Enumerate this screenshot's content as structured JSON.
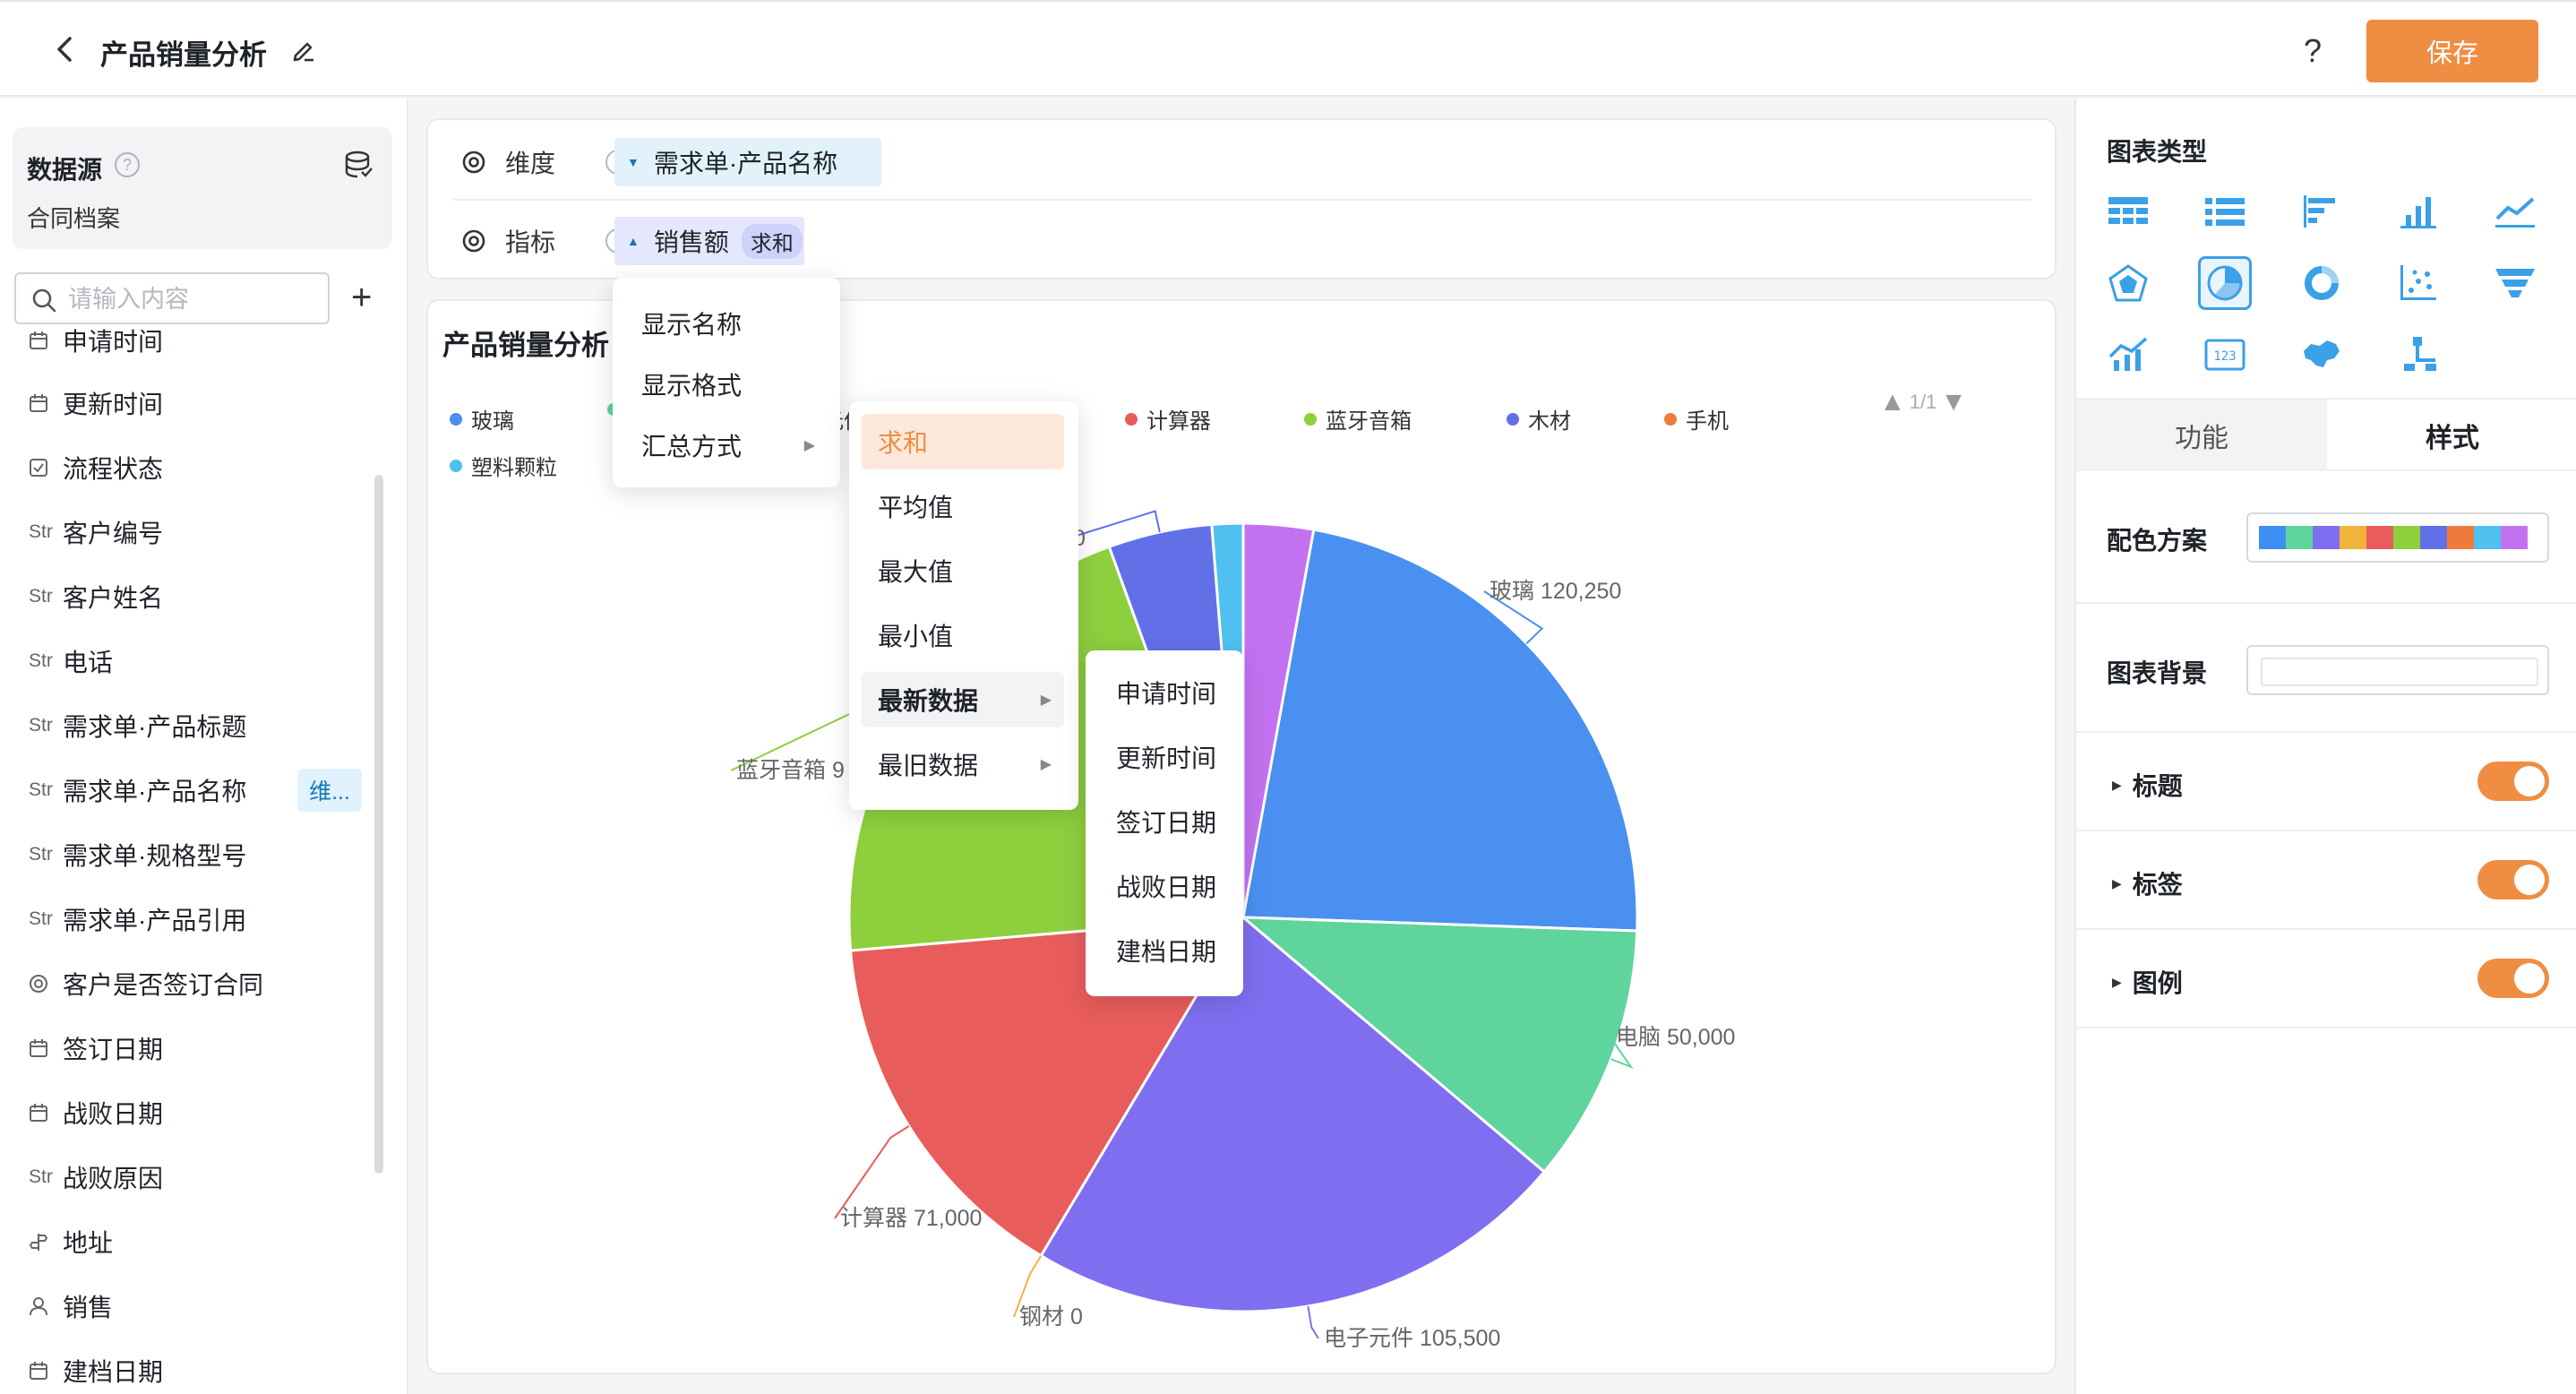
{
  "header": {
    "title": "产品销量分析",
    "help": "?",
    "save_label": "保存"
  },
  "datasource": {
    "title": "数据源",
    "help": "?",
    "name": "合同档案"
  },
  "search": {
    "placeholder": "请输入内容",
    "add": "+"
  },
  "fields": [
    {
      "type": "date",
      "label": "申请时间"
    },
    {
      "type": "date",
      "label": "更新时间"
    },
    {
      "type": "check",
      "label": "流程状态"
    },
    {
      "type": "Str",
      "label": "客户编号"
    },
    {
      "type": "Str",
      "label": "客户姓名"
    },
    {
      "type": "Str",
      "label": "电话"
    },
    {
      "type": "Str",
      "label": "需求单·产品标题"
    },
    {
      "type": "Str",
      "label": "需求单·产品名称",
      "tag": "维..."
    },
    {
      "type": "Str",
      "label": "需求单·规格型号"
    },
    {
      "type": "Str",
      "label": "需求单·产品引用"
    },
    {
      "type": "radio",
      "label": "客户是否签订合同"
    },
    {
      "type": "date",
      "label": "签订日期"
    },
    {
      "type": "date",
      "label": "战败日期"
    },
    {
      "type": "Str",
      "label": "战败原因"
    },
    {
      "type": "address",
      "label": "地址"
    },
    {
      "type": "user",
      "label": "销售"
    },
    {
      "type": "date",
      "label": "建档日期"
    }
  ],
  "config": {
    "dimension_label": "维度",
    "dimension_value": "需求单·产品名称",
    "measure_label": "指标",
    "measure_value": "销售额",
    "measure_agg": "求和",
    "help": "?"
  },
  "menus": {
    "field_menu": [
      "显示名称",
      "显示格式",
      "汇总方式"
    ],
    "agg_menu": [
      "求和",
      "平均值",
      "最大值",
      "最小值",
      "最新数据",
      "最旧数据"
    ],
    "date_menu": [
      "申请时间",
      "更新时间",
      "签订日期",
      "战败日期",
      "建档日期"
    ]
  },
  "chart_data": {
    "type": "pie",
    "title": "产品销量分析",
    "categories": [
      "玻璃",
      "电脑",
      "电子元件",
      "钢材",
      "计算器",
      "蓝牙音箱",
      "木材",
      "手机",
      "塑料颗粒"
    ],
    "values": [
      120250,
      50000,
      105500,
      0,
      71000,
      98000,
      20000,
      0,
      6000
    ],
    "legend_visible": [
      "玻璃",
      "",
      "元件",
      "钢材",
      "计算器",
      "蓝牙音箱",
      "木材",
      "手机",
      "塑料颗粒"
    ],
    "labels_visible": {
      "glass": "玻璃 120,250",
      "computer": "电脑 50,000",
      "electronic": "电子元件 105,500",
      "steel": "钢材 0",
      "calculator": "计算器 71,000",
      "speaker": "蓝牙音箱 9",
      "small": "0"
    },
    "legend_pager": "1/1",
    "legend_placement": "top",
    "colors": [
      "#4a90f0",
      "#5fd49c",
      "#7f6ef0",
      "#f0b43c",
      "#e85c5c",
      "#8ecf3e",
      "#6270e8",
      "#f07a3c",
      "#50c0f0",
      "#c272f0"
    ]
  },
  "right_panel": {
    "chart_type_title": "图表类型",
    "tabs": [
      "功能",
      "样式"
    ],
    "palette_label": "配色方案",
    "palette_colors": [
      "#3f8ef4",
      "#5fd49c",
      "#7f6ef0",
      "#f0b43c",
      "#e85c5c",
      "#8ecf3e",
      "#6270e8",
      "#f07a3c",
      "#50c0f0",
      "#c272f0"
    ],
    "background_label": "图表背景",
    "sections": [
      "标题",
      "标签",
      "图例"
    ]
  },
  "theme": {
    "accent": "#ef8d43",
    "selected_blue": "#3aa0e8"
  }
}
